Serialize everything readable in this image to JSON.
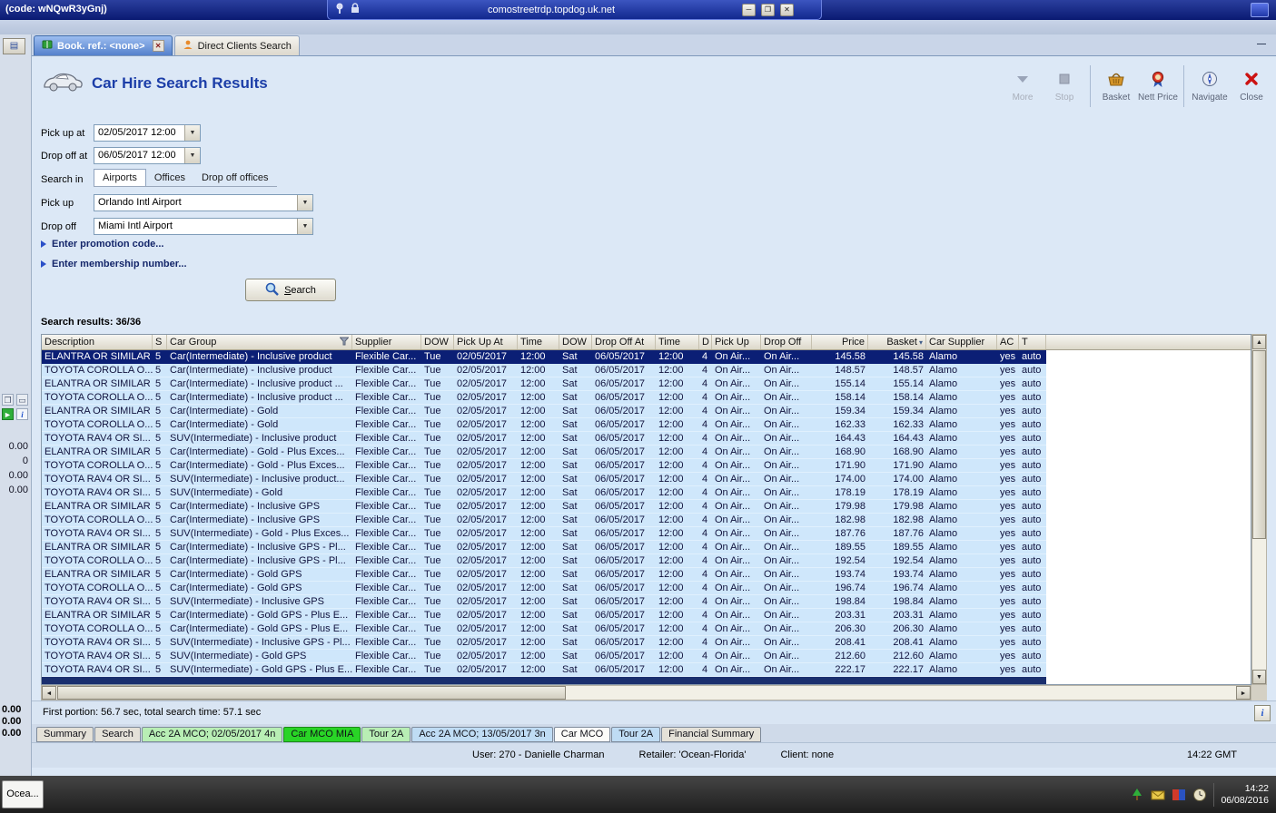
{
  "rdp": {
    "code": "(code: wNQwR3yGnj)",
    "host": "comostreetrdp.topdog.uk.net"
  },
  "tabs": [
    {
      "label": "Book. ref.: <none>",
      "icon": "book-icon",
      "active": true,
      "closable": true
    },
    {
      "label": "Direct Clients Search",
      "icon": "client-icon",
      "active": false,
      "closable": false
    }
  ],
  "header": {
    "title": "Car Hire Search Results"
  },
  "toolbar": [
    {
      "label": "More",
      "icon": "more-icon",
      "disabled": true
    },
    {
      "label": "Stop",
      "icon": "stop-icon",
      "disabled": true,
      "group_end": true
    },
    {
      "label": "Basket",
      "icon": "basket-icon",
      "disabled": false
    },
    {
      "label": "Nett Price",
      "icon": "nett-price-icon",
      "disabled": false,
      "group_end": true
    },
    {
      "label": "Navigate",
      "icon": "navigate-icon",
      "disabled": false
    },
    {
      "label": "Close",
      "icon": "close-icon",
      "disabled": false
    }
  ],
  "form": {
    "pick_up_at_label": "Pick up at",
    "pick_up_at_value": "02/05/2017 12:00",
    "drop_off_at_label": "Drop off at",
    "drop_off_at_value": "06/05/2017 12:00",
    "search_in_label": "Search in",
    "search_in_tabs": [
      {
        "label": "Airports",
        "active": true
      },
      {
        "label": "Offices",
        "active": false
      },
      {
        "label": "Drop off offices",
        "active": false
      }
    ],
    "pick_up_label": "Pick up",
    "pick_up_value": "Orlando Intl Airport",
    "drop_off_label": "Drop off",
    "drop_off_value": "Miami Intl Airport",
    "promo_expander": "Enter promotion code...",
    "membership_expander": "Enter membership number...",
    "search_button": "Search"
  },
  "results": {
    "summary": "Search results: 36/36",
    "filter_column": "Car Group",
    "sort_column": "Basket",
    "selected_row": 0,
    "columns": [
      "Description",
      "S",
      "Car Group",
      "Supplier",
      "DOW",
      "Pick Up At",
      "Time",
      "DOW",
      "Drop Off At",
      "Time",
      "D",
      "Pick Up",
      "Drop Off",
      "Price",
      "Basket",
      "Car Supplier",
      "AC",
      "T"
    ],
    "rows": [
      [
        "ELANTRA OR SIMILAR",
        "5",
        "Car(Intermediate) - Inclusive product",
        "Flexible Car...",
        "Tue",
        "02/05/2017",
        "12:00",
        "Sat",
        "06/05/2017",
        "12:00",
        "4",
        "On Air...",
        "On Air...",
        "145.58",
        "145.58",
        "Alamo",
        "yes",
        "auto"
      ],
      [
        "TOYOTA COROLLA O...",
        "5",
        "Car(Intermediate) - Inclusive product",
        "Flexible Car...",
        "Tue",
        "02/05/2017",
        "12:00",
        "Sat",
        "06/05/2017",
        "12:00",
        "4",
        "On Air...",
        "On Air...",
        "148.57",
        "148.57",
        "Alamo",
        "yes",
        "auto"
      ],
      [
        "ELANTRA OR SIMILAR",
        "5",
        "Car(Intermediate) - Inclusive product ...",
        "Flexible Car...",
        "Tue",
        "02/05/2017",
        "12:00",
        "Sat",
        "06/05/2017",
        "12:00",
        "4",
        "On Air...",
        "On Air...",
        "155.14",
        "155.14",
        "Alamo",
        "yes",
        "auto"
      ],
      [
        "TOYOTA COROLLA O...",
        "5",
        "Car(Intermediate) - Inclusive product ...",
        "Flexible Car...",
        "Tue",
        "02/05/2017",
        "12:00",
        "Sat",
        "06/05/2017",
        "12:00",
        "4",
        "On Air...",
        "On Air...",
        "158.14",
        "158.14",
        "Alamo",
        "yes",
        "auto"
      ],
      [
        "ELANTRA OR SIMILAR",
        "5",
        "Car(Intermediate) - Gold",
        "Flexible Car...",
        "Tue",
        "02/05/2017",
        "12:00",
        "Sat",
        "06/05/2017",
        "12:00",
        "4",
        "On Air...",
        "On Air...",
        "159.34",
        "159.34",
        "Alamo",
        "yes",
        "auto"
      ],
      [
        "TOYOTA COROLLA O...",
        "5",
        "Car(Intermediate) - Gold",
        "Flexible Car...",
        "Tue",
        "02/05/2017",
        "12:00",
        "Sat",
        "06/05/2017",
        "12:00",
        "4",
        "On Air...",
        "On Air...",
        "162.33",
        "162.33",
        "Alamo",
        "yes",
        "auto"
      ],
      [
        "TOYOTA RAV4 OR SI...",
        "5",
        "SUV(Intermediate) - Inclusive product",
        "Flexible Car...",
        "Tue",
        "02/05/2017",
        "12:00",
        "Sat",
        "06/05/2017",
        "12:00",
        "4",
        "On Air...",
        "On Air...",
        "164.43",
        "164.43",
        "Alamo",
        "yes",
        "auto"
      ],
      [
        "ELANTRA OR SIMILAR",
        "5",
        "Car(Intermediate) - Gold - Plus Exces...",
        "Flexible Car...",
        "Tue",
        "02/05/2017",
        "12:00",
        "Sat",
        "06/05/2017",
        "12:00",
        "4",
        "On Air...",
        "On Air...",
        "168.90",
        "168.90",
        "Alamo",
        "yes",
        "auto"
      ],
      [
        "TOYOTA COROLLA O...",
        "5",
        "Car(Intermediate) - Gold - Plus Exces...",
        "Flexible Car...",
        "Tue",
        "02/05/2017",
        "12:00",
        "Sat",
        "06/05/2017",
        "12:00",
        "4",
        "On Air...",
        "On Air...",
        "171.90",
        "171.90",
        "Alamo",
        "yes",
        "auto"
      ],
      [
        "TOYOTA RAV4 OR SI...",
        "5",
        "SUV(Intermediate) - Inclusive product...",
        "Flexible Car...",
        "Tue",
        "02/05/2017",
        "12:00",
        "Sat",
        "06/05/2017",
        "12:00",
        "4",
        "On Air...",
        "On Air...",
        "174.00",
        "174.00",
        "Alamo",
        "yes",
        "auto"
      ],
      [
        "TOYOTA RAV4 OR SI...",
        "5",
        "SUV(Intermediate) - Gold",
        "Flexible Car...",
        "Tue",
        "02/05/2017",
        "12:00",
        "Sat",
        "06/05/2017",
        "12:00",
        "4",
        "On Air...",
        "On Air...",
        "178.19",
        "178.19",
        "Alamo",
        "yes",
        "auto"
      ],
      [
        "ELANTRA OR SIMILAR",
        "5",
        "Car(Intermediate) - Inclusive GPS",
        "Flexible Car...",
        "Tue",
        "02/05/2017",
        "12:00",
        "Sat",
        "06/05/2017",
        "12:00",
        "4",
        "On Air...",
        "On Air...",
        "179.98",
        "179.98",
        "Alamo",
        "yes",
        "auto"
      ],
      [
        "TOYOTA COROLLA O...",
        "5",
        "Car(Intermediate) - Inclusive GPS",
        "Flexible Car...",
        "Tue",
        "02/05/2017",
        "12:00",
        "Sat",
        "06/05/2017",
        "12:00",
        "4",
        "On Air...",
        "On Air...",
        "182.98",
        "182.98",
        "Alamo",
        "yes",
        "auto"
      ],
      [
        "TOYOTA RAV4 OR SI...",
        "5",
        "SUV(Intermediate) - Gold - Plus Exces...",
        "Flexible Car...",
        "Tue",
        "02/05/2017",
        "12:00",
        "Sat",
        "06/05/2017",
        "12:00",
        "4",
        "On Air...",
        "On Air...",
        "187.76",
        "187.76",
        "Alamo",
        "yes",
        "auto"
      ],
      [
        "ELANTRA OR SIMILAR",
        "5",
        "Car(Intermediate) - Inclusive GPS - Pl...",
        "Flexible Car...",
        "Tue",
        "02/05/2017",
        "12:00",
        "Sat",
        "06/05/2017",
        "12:00",
        "4",
        "On Air...",
        "On Air...",
        "189.55",
        "189.55",
        "Alamo",
        "yes",
        "auto"
      ],
      [
        "TOYOTA COROLLA O...",
        "5",
        "Car(Intermediate) - Inclusive GPS - Pl...",
        "Flexible Car...",
        "Tue",
        "02/05/2017",
        "12:00",
        "Sat",
        "06/05/2017",
        "12:00",
        "4",
        "On Air...",
        "On Air...",
        "192.54",
        "192.54",
        "Alamo",
        "yes",
        "auto"
      ],
      [
        "ELANTRA OR SIMILAR",
        "5",
        "Car(Intermediate) - Gold GPS",
        "Flexible Car...",
        "Tue",
        "02/05/2017",
        "12:00",
        "Sat",
        "06/05/2017",
        "12:00",
        "4",
        "On Air...",
        "On Air...",
        "193.74",
        "193.74",
        "Alamo",
        "yes",
        "auto"
      ],
      [
        "TOYOTA COROLLA O...",
        "5",
        "Car(Intermediate) - Gold GPS",
        "Flexible Car...",
        "Tue",
        "02/05/2017",
        "12:00",
        "Sat",
        "06/05/2017",
        "12:00",
        "4",
        "On Air...",
        "On Air...",
        "196.74",
        "196.74",
        "Alamo",
        "yes",
        "auto"
      ],
      [
        "TOYOTA RAV4 OR SI...",
        "5",
        "SUV(Intermediate) - Inclusive GPS",
        "Flexible Car...",
        "Tue",
        "02/05/2017",
        "12:00",
        "Sat",
        "06/05/2017",
        "12:00",
        "4",
        "On Air...",
        "On Air...",
        "198.84",
        "198.84",
        "Alamo",
        "yes",
        "auto"
      ],
      [
        "ELANTRA OR SIMILAR",
        "5",
        "Car(Intermediate) - Gold GPS - Plus E...",
        "Flexible Car...",
        "Tue",
        "02/05/2017",
        "12:00",
        "Sat",
        "06/05/2017",
        "12:00",
        "4",
        "On Air...",
        "On Air...",
        "203.31",
        "203.31",
        "Alamo",
        "yes",
        "auto"
      ],
      [
        "TOYOTA COROLLA O...",
        "5",
        "Car(Intermediate) - Gold GPS - Plus E...",
        "Flexible Car...",
        "Tue",
        "02/05/2017",
        "12:00",
        "Sat",
        "06/05/2017",
        "12:00",
        "4",
        "On Air...",
        "On Air...",
        "206.30",
        "206.30",
        "Alamo",
        "yes",
        "auto"
      ],
      [
        "TOYOTA RAV4 OR SI...",
        "5",
        "SUV(Intermediate) - Inclusive GPS - Pl...",
        "Flexible Car...",
        "Tue",
        "02/05/2017",
        "12:00",
        "Sat",
        "06/05/2017",
        "12:00",
        "4",
        "On Air...",
        "On Air...",
        "208.41",
        "208.41",
        "Alamo",
        "yes",
        "auto"
      ],
      [
        "TOYOTA RAV4 OR SI...",
        "5",
        "SUV(Intermediate) - Gold GPS",
        "Flexible Car...",
        "Tue",
        "02/05/2017",
        "12:00",
        "Sat",
        "06/05/2017",
        "12:00",
        "4",
        "On Air...",
        "On Air...",
        "212.60",
        "212.60",
        "Alamo",
        "yes",
        "auto"
      ],
      [
        "TOYOTA RAV4 OR SI...",
        "5",
        "SUV(Intermediate) - Gold GPS - Plus E...",
        "Flexible Car...",
        "Tue",
        "02/05/2017",
        "12:00",
        "Sat",
        "06/05/2017",
        "12:00",
        "4",
        "On Air...",
        "On Air...",
        "222.17",
        "222.17",
        "Alamo",
        "yes",
        "auto"
      ]
    ]
  },
  "footer": {
    "timing": "First portion: 56.7 sec, total search time: 57.1 sec"
  },
  "bottom_tabs": [
    {
      "label": "Summary",
      "color": "default",
      "active": false
    },
    {
      "label": "Search",
      "color": "default",
      "active": false
    },
    {
      "label": "Acc 2A MCO; 02/05/2017 4n",
      "color": "lightgreen",
      "active": false
    },
    {
      "label": "Car MCO MIA",
      "color": "green",
      "active": true
    },
    {
      "label": "Tour 2A",
      "color": "lightgreen",
      "active": false
    },
    {
      "label": "Acc 2A MCO; 13/05/2017 3n",
      "color": "lightblue",
      "active": false
    },
    {
      "label": "Car MCO",
      "color": "white",
      "active": false
    },
    {
      "label": "Tour 2A",
      "color": "lightblue",
      "active": false
    },
    {
      "label": "Financial Summary",
      "color": "default",
      "active": false
    }
  ],
  "status_bar": {
    "user": "User: 270 - Danielle Charman",
    "retailer": "Retailer: 'Ocean-Florida'",
    "client": "Client: none",
    "right": "14:22 GMT"
  },
  "sidebar": {
    "values": [
      "0.00",
      "0",
      "0.00",
      "0.00"
    ],
    "totals": [
      "0.00",
      "0.00",
      "0.00"
    ]
  },
  "taskbar": {
    "start": "Ocea...",
    "time": "14:22",
    "date": "06/08/2016"
  }
}
